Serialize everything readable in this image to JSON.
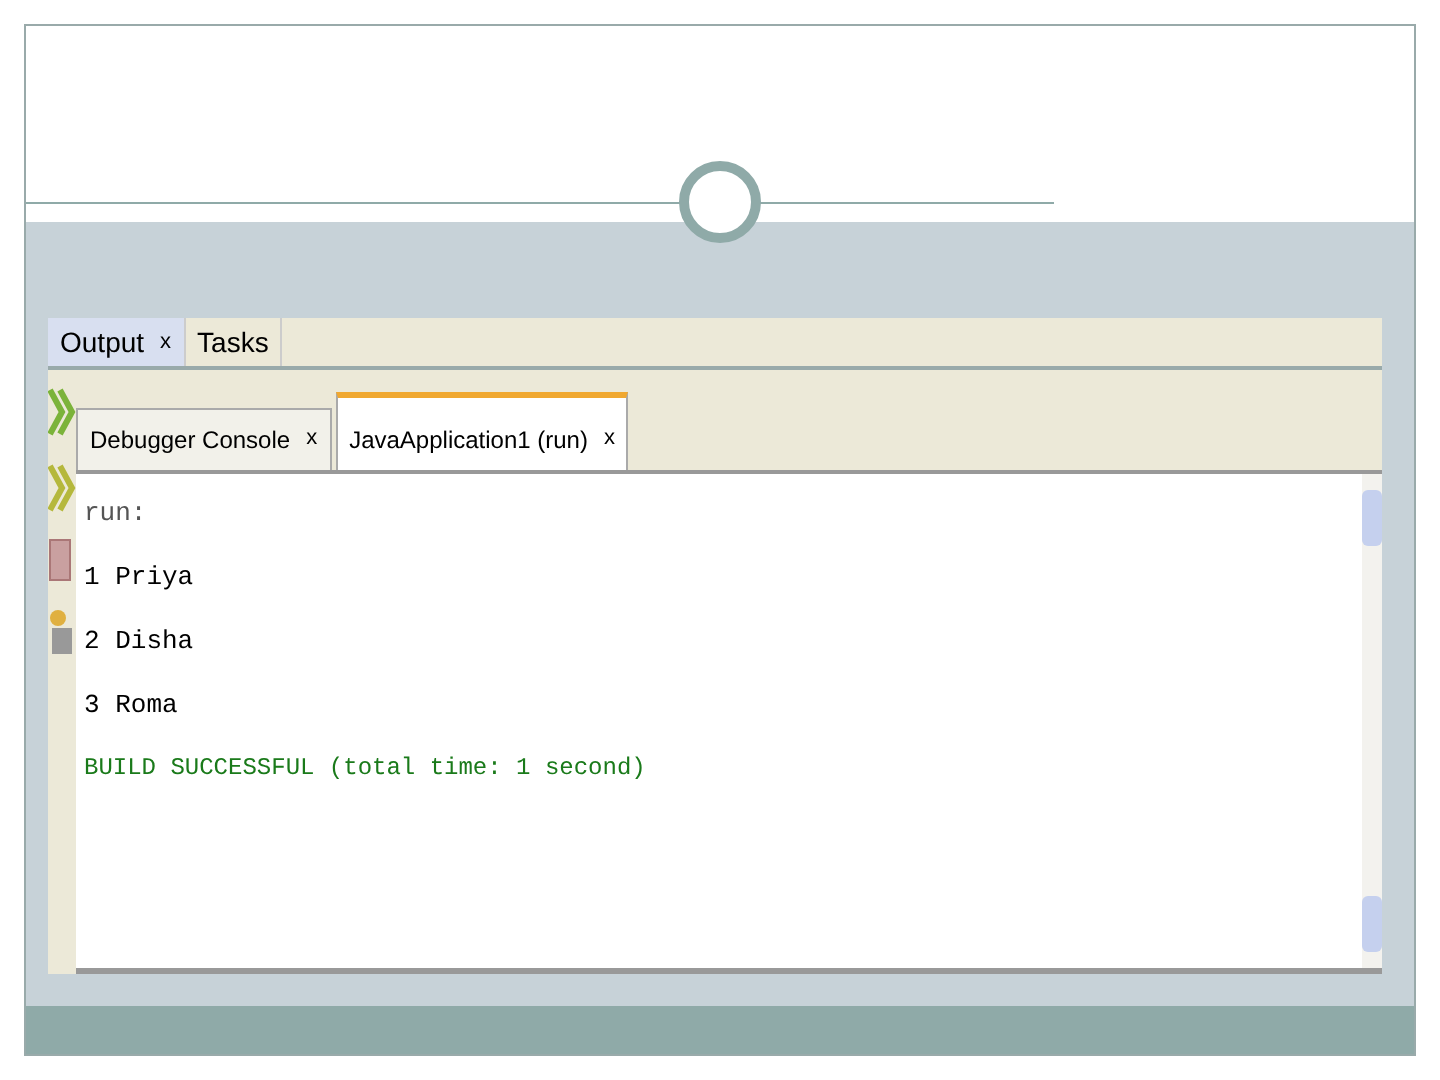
{
  "output_window": {
    "tabs": [
      {
        "label": "Output",
        "close": "x",
        "selected": true
      },
      {
        "label": "Tasks",
        "selected": false
      }
    ],
    "console_tabs": [
      {
        "label": "Debugger Console",
        "close": "x",
        "selected": false
      },
      {
        "label": "JavaApplication1 (run)",
        "close": "x",
        "selected": true
      }
    ],
    "lines": [
      {
        "text": "run:",
        "kind": "info"
      },
      {
        "text": "1 Priya",
        "kind": "plain"
      },
      {
        "text": "2 Disha",
        "kind": "plain"
      },
      {
        "text": "3 Roma",
        "kind": "plain"
      },
      {
        "text": "BUILD SUCCESSFUL (total time: 1 second)",
        "kind": "success"
      }
    ]
  }
}
